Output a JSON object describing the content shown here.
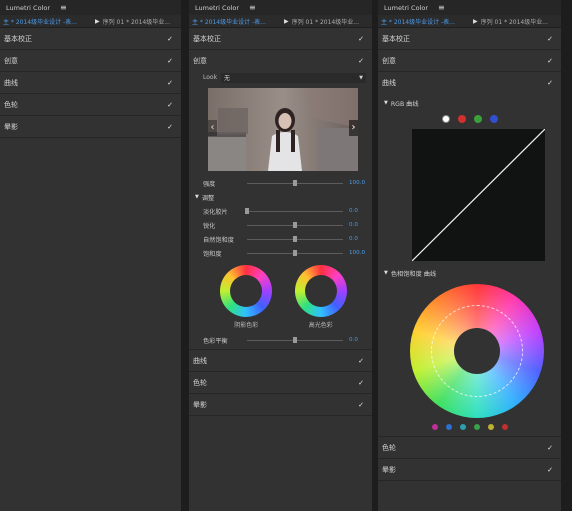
{
  "panel_title": "Lumetri Color",
  "menu_icon": "hamburger-menu-icon",
  "tab_master": "主 * 2014级毕业设计 -表...",
  "tab_sequence": "序列 01 * 2014级毕业...",
  "sections": {
    "basic": "基本校正",
    "creative": "创意",
    "curves": "曲线",
    "wheels": "色轮",
    "vignette": "晕影"
  },
  "creative": {
    "look_label": "Look",
    "look_value": "无",
    "intensity_label": "强度",
    "intensity_value": "100.0",
    "adjust_label": "调整",
    "fade_label": "淡化胶片",
    "fade_value": "0.0",
    "sharpen_label": "锐化",
    "sharpen_value": "0.0",
    "vibrance_label": "自然饱和度",
    "vibrance_value": "0.0",
    "saturation_label": "饱和度",
    "saturation_value": "100.0",
    "shadow_tint_label": "阴影色彩",
    "highlight_tint_label": "高光色彩",
    "tint_balance_label": "色彩平衡",
    "tint_balance_value": "0.0",
    "preview_image": "preview-photo-girl"
  },
  "curves": {
    "rgb_label": "RGB 曲线",
    "channel_colors": [
      "#ffffff",
      "#d03030",
      "#3aa03a",
      "#3050d0"
    ],
    "hue_sat_label": "色相饱和度 曲线",
    "swatch_colors": [
      "#c0309a",
      "#2e6fd0",
      "#2aa0b0",
      "#3aa04a",
      "#c0b030",
      "#c03030"
    ]
  }
}
